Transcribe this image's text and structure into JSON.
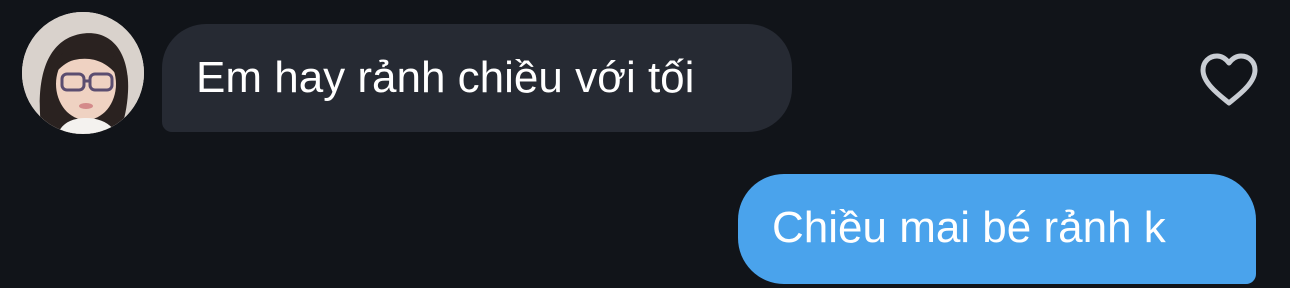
{
  "conversation": {
    "incoming": {
      "text": "Em hay rảnh chiều với tối",
      "bubble_color": "#262a33"
    },
    "outgoing": {
      "text": "Chiều mai bé rảnh k",
      "bubble_color": "#4aa3ec"
    },
    "like_icon": "heart-outline-icon"
  },
  "theme": {
    "background": "#111419",
    "text_color": "#ffffff",
    "icon_color": "#c9cdd3"
  }
}
